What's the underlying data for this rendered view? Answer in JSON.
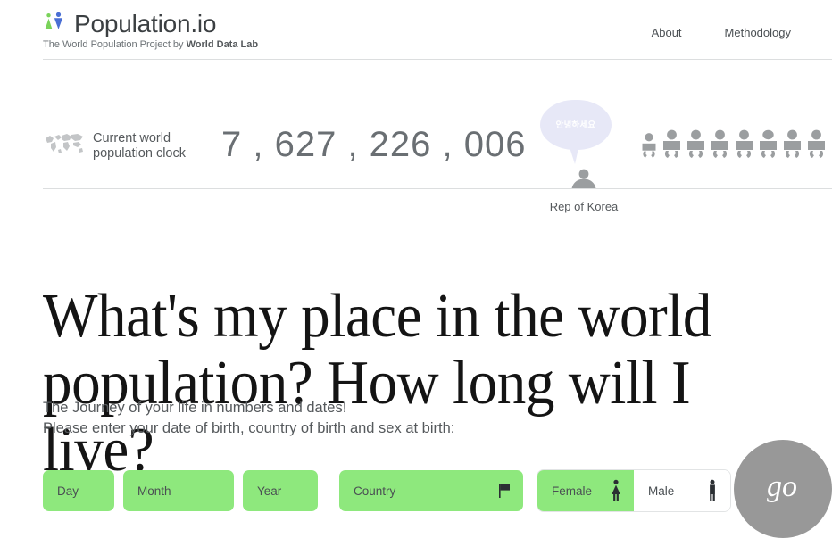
{
  "header": {
    "logo_icon": "two-person-pictogram",
    "brand_title": "Population.io",
    "tagline_prefix": "The World Population Project by ",
    "tagline_strong": "World Data Lab",
    "nav": [
      {
        "label": "About",
        "name": "about"
      },
      {
        "label": "Methodology",
        "name": "methodology"
      }
    ]
  },
  "clock": {
    "map_icon": "world-map-icon",
    "label_line1": "Current world",
    "label_line2": "population clock",
    "value": "7 , 627 , 226 , 006",
    "value_plain": "7,627,226,006"
  },
  "korea": {
    "bubble_text": "안녕하세요",
    "caption": "Rep of Korea",
    "person_icon": "person-bust-icon",
    "bubble_color": "#e7e8f7"
  },
  "babies": {
    "icon": "baby-pictogram-icon",
    "count": 8
  },
  "headline": "What's my place in the world population? How long will I live?",
  "subtext": {
    "line1": "The Journey of your life in numbers and dates!",
    "line2": "Please enter your date of birth, country of birth and sex at birth:"
  },
  "form": {
    "day": {
      "placeholder": "Day",
      "value": ""
    },
    "month": {
      "placeholder": "Month",
      "value": ""
    },
    "year": {
      "placeholder": "Year",
      "value": ""
    },
    "country": {
      "placeholder": "Country",
      "value": "",
      "icon": "flag-icon"
    },
    "sex": {
      "female_label": "Female",
      "female_icon": "female-pictogram-icon",
      "male_label": "Male",
      "male_icon": "male-pictogram-icon",
      "selected": "Female"
    },
    "submit_label": "go"
  },
  "colors": {
    "field_green": "#8ee87d",
    "go_gray": "#989898",
    "text_gray": "#55595c",
    "bubble_lavender": "#e7e8f7",
    "logo_green": "#7ad35a",
    "logo_blue": "#4a6fd4"
  }
}
